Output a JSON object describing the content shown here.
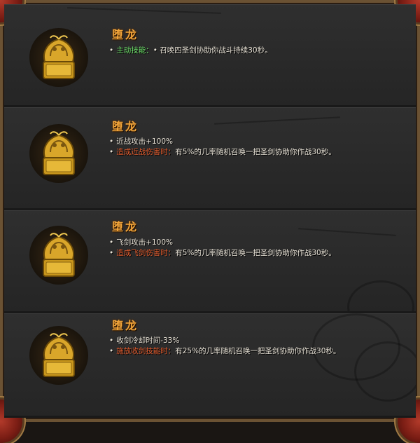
{
  "items": [
    {
      "title": "堕龙",
      "lines": [
        {
          "label": "主动技能：",
          "label_color": "green",
          "text": "• 召唤四圣剑协助你战斗持续30秒。"
        }
      ]
    },
    {
      "title": "堕龙",
      "lines": [
        {
          "label": "",
          "text": "近战攻击+100%"
        },
        {
          "label": "造成近战伤害时：",
          "label_color": "red",
          "text": "有5%的几率随机召唤一把圣剑协助你作战30秒。"
        }
      ]
    },
    {
      "title": "堕龙",
      "lines": [
        {
          "label": "",
          "text": "飞剑攻击+100%"
        },
        {
          "label": "造成飞剑伤害时：",
          "label_color": "red",
          "text": "有5%的几率随机召唤一把圣剑协助你作战30秒。"
        }
      ]
    },
    {
      "title": "堕龙",
      "lines": [
        {
          "label": "",
          "text": "收剑冷却时间-33%"
        },
        {
          "label": "施放收剑技能时：",
          "label_color": "red",
          "text": "有25%的几率随机召唤一把圣剑协助你作战30秒。"
        }
      ]
    }
  ],
  "icon": "golden-dragon-seal-icon",
  "colors": {
    "title": "#f0a43a",
    "label_green": "#6ee06a",
    "label_red": "#e05a2c",
    "text": "#e8e2d6",
    "panel": "#2b2b2b",
    "frame": "#6b5233"
  }
}
